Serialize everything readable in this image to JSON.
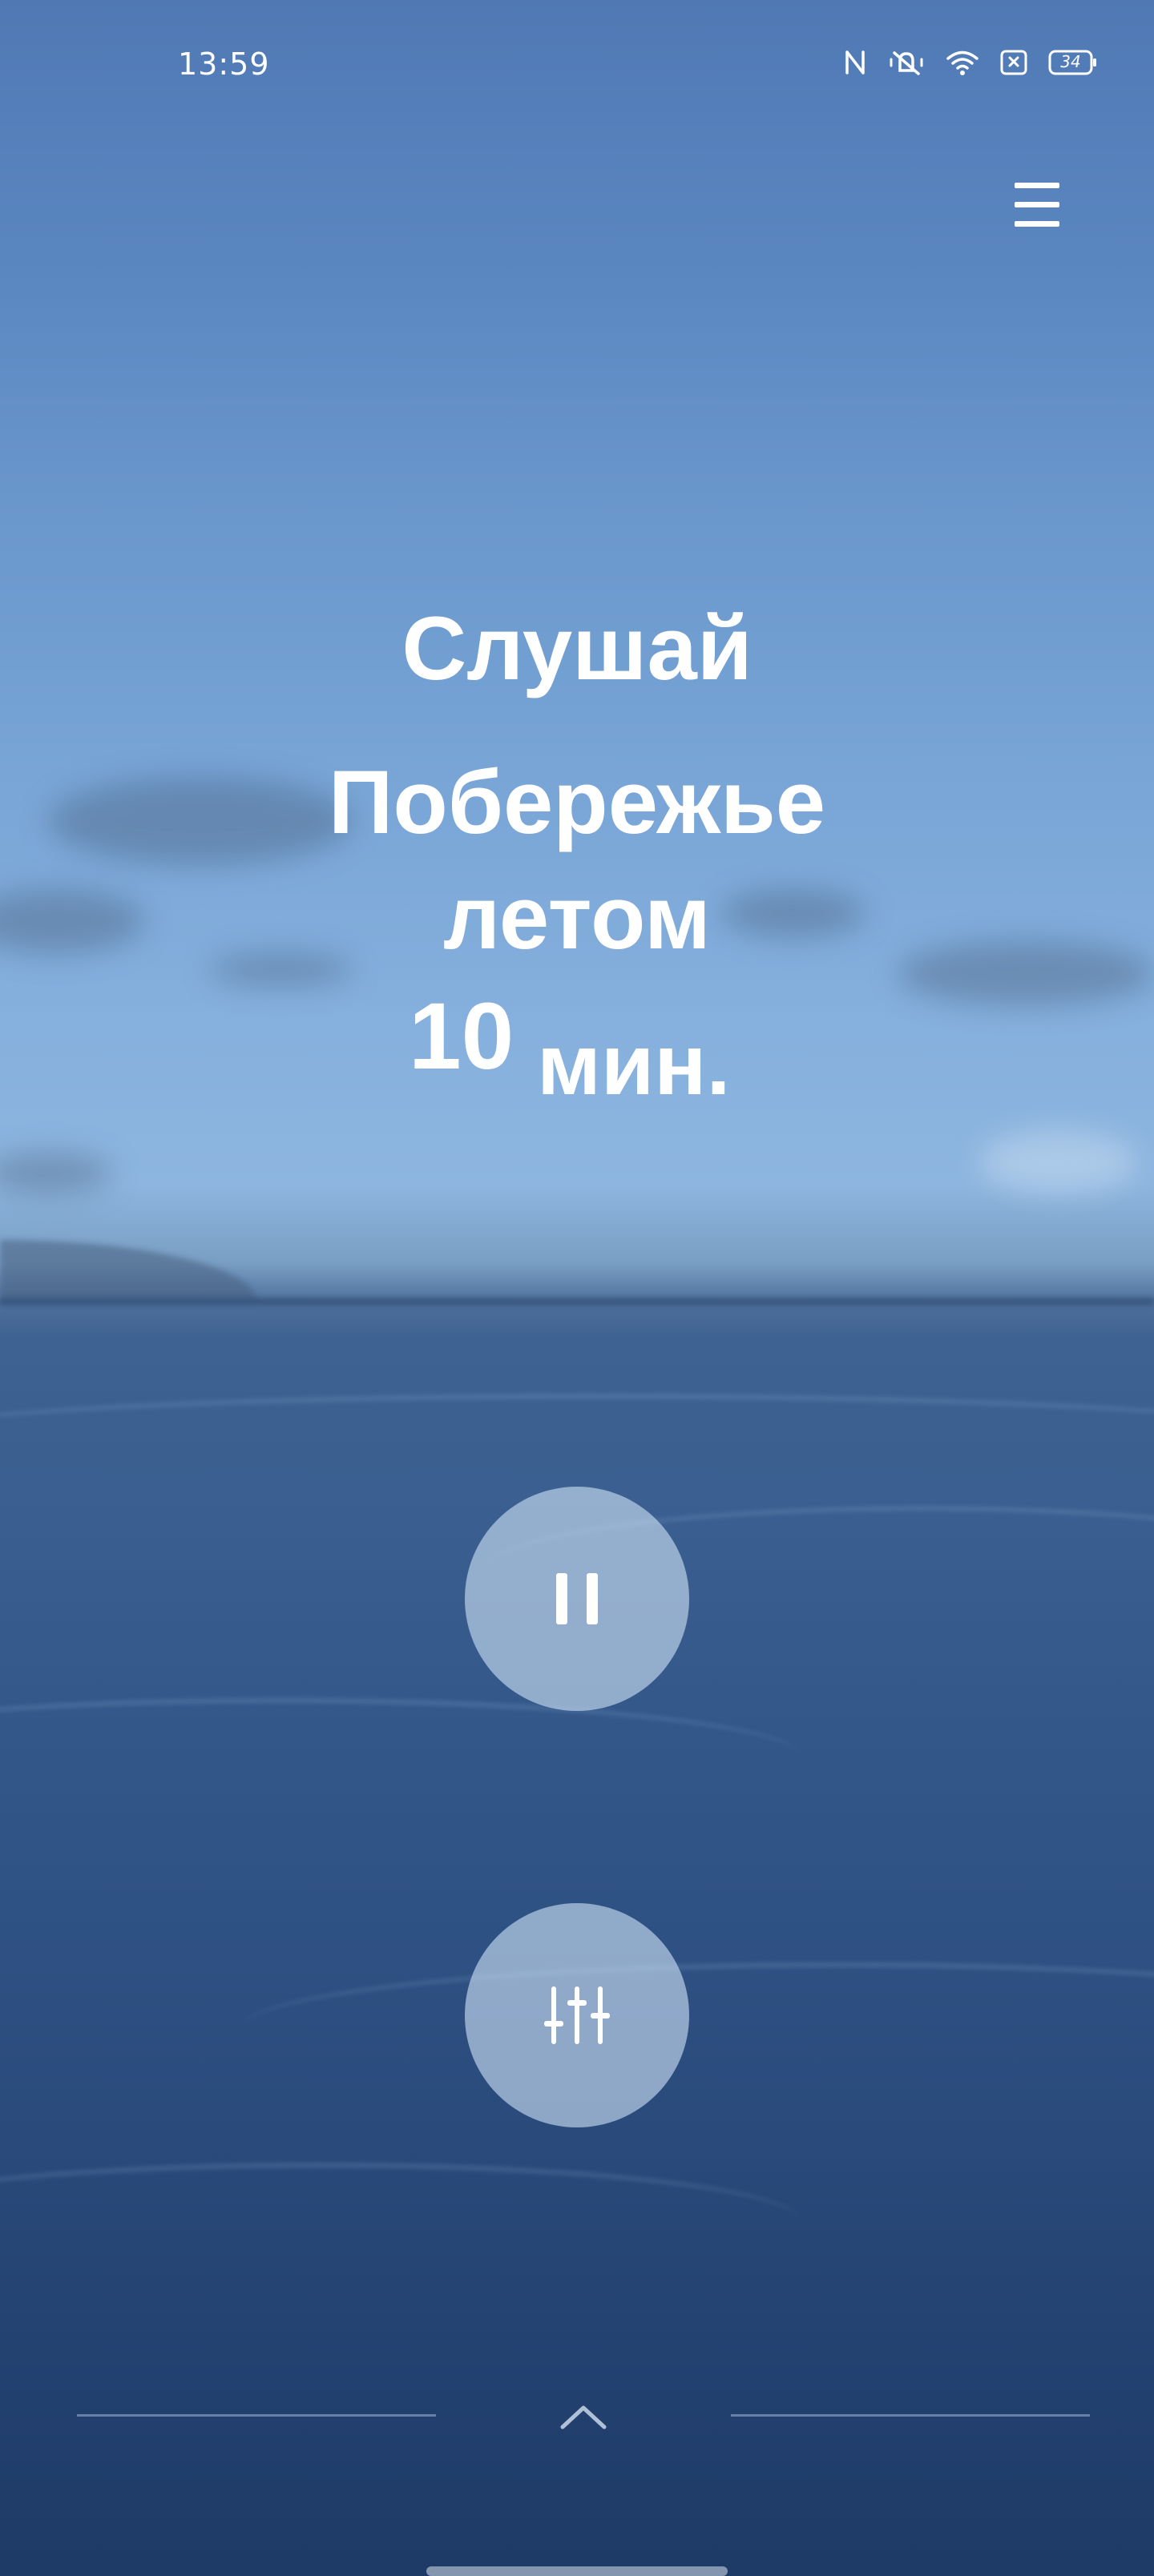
{
  "status_bar": {
    "time": "13:59",
    "battery_level": "34",
    "icons": [
      "nfc-icon",
      "mute-vibrate-icon",
      "wifi-icon",
      "close-box-icon",
      "battery-icon"
    ]
  },
  "header": {
    "menu_icon": "hamburger-menu-icon"
  },
  "session": {
    "label": "Слушай",
    "track_line_1": "Побережье",
    "track_line_2": "летом",
    "duration_value": "10",
    "duration_unit": "мин."
  },
  "controls": {
    "pause_icon": "pause-icon",
    "mixer_icon": "sliders-icon",
    "expand_icon": "chevron-up-icon"
  },
  "colors": {
    "sky_top": "#5079b4",
    "sky_bottom": "#8db5df",
    "sea": "#2f5284",
    "button_fill": "#cde1f5",
    "text": "#ffffff"
  }
}
